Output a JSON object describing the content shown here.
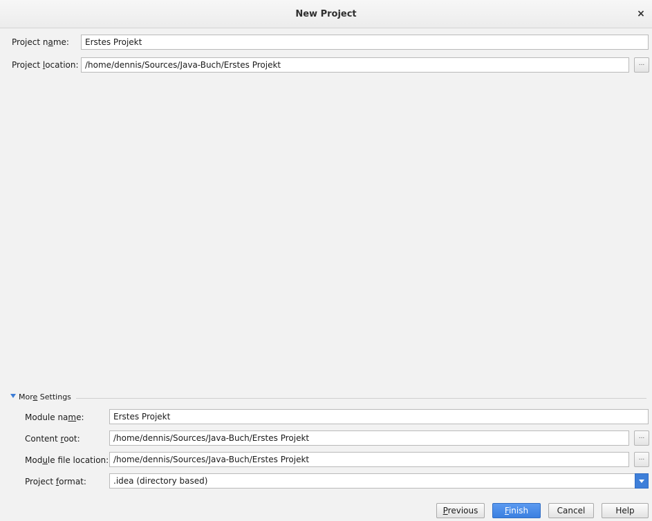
{
  "window": {
    "title": "New Project",
    "close_glyph": "×"
  },
  "project": {
    "name_label_pre": "Project n",
    "name_label_mn": "a",
    "name_label_post": "me:",
    "name_value": "Erstes Projekt",
    "location_label_pre": "Project ",
    "location_label_mn": "l",
    "location_label_post": "ocation:",
    "location_value": "/home/dennis/Sources/Java-Buch/Erstes Projekt",
    "browse_glyph": "..."
  },
  "more_settings": {
    "label_pre": "Mor",
    "label_mn": "e",
    "label_post": " Settings",
    "expanded": true,
    "module_name_label_pre": "Module na",
    "module_name_label_mn": "m",
    "module_name_label_post": "e:",
    "module_name_value": "Erstes Projekt",
    "content_root_label_pre": "Content ",
    "content_root_label_mn": "r",
    "content_root_label_post": "oot:",
    "content_root_value": "/home/dennis/Sources/Java-Buch/Erstes Projekt",
    "module_file_label_pre": "Mod",
    "module_file_label_mn": "u",
    "module_file_label_post": "le file location:",
    "module_file_value": "/home/dennis/Sources/Java-Buch/Erstes Projekt",
    "project_format_label_pre": "Project ",
    "project_format_label_mn": "f",
    "project_format_label_post": "ormat:",
    "project_format_value": ".idea (directory based)",
    "browse_glyph": "..."
  },
  "buttons": {
    "previous_mn": "P",
    "previous_rest": "revious",
    "finish_mn": "F",
    "finish_rest": "inish",
    "cancel": "Cancel",
    "help": "Help"
  },
  "colors": {
    "accent": "#3e7fd9",
    "background": "#f2f2f2"
  }
}
